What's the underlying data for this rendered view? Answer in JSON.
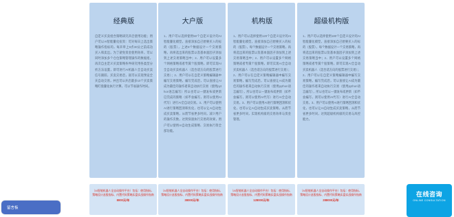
{
  "plans": [
    {
      "title": "经典版",
      "description": "自定义买卖组合策略研究开启使用功能；用户可以AI智能量化投资：可对每日上选出策略操作指标的，每开单上9点30分之前成功买入和卖出，为了避免资金使用效率，可以同时添加多个仓位策略管理操作的数据组，再次自主定义买卖策略条件研究用各类型分析方法设置，即可进行AI机器人全自动买卖信号跟踪，买卖交易后，就可以实现预设全天自动交易，并且可以开启最多10个买卖策略盯盘量化执行计算，可以节省操作时间。",
      "price_note": "（AI智能机器人全自动操作平台）包括：使用指标、策略设计选股指标、内置代码策略实盘实战操作指南",
      "price": "8000元/年"
    },
    {
      "title": "大户版",
      "description": "1、用户可以选择使用50个自定义设计的AI智能量化模型，直接添加自己想要买入的标的（股票），上述8个数据设计一个交易策略，再将选出来的股票以及基本面因子添加到上述交易策略当中；2、用户可以设置多个网格策略或者专属个股策略，即可实现AI全自动买卖机器人（选合适方向的股票进行交易）；2、用户可以在自定义策略编辑器中编写交易策略，编写完成后，可以直接让AI成为最佳的操作者来自动执行交易（使用python语言编写）所以也可以一键发布或更新已完成的策略（如不会编写，则可以使用AI代写）进行AI全自动交易。3、用户可以使用AI进行策略回测和优化，也可以让AI自动生成买卖策略，从而节省更多时间，减少用户的操作次数，达到快速执行交易的效果，用户可以使用AI自动生成策略、交易执行等全部功能。",
      "price_note": "（AI智能机器人全自动操作平台）包括：使用指标、策略设计选股指标、内置代码策略实盘实战操作指南",
      "price": "38000元/年"
    },
    {
      "title": "机构版",
      "description": "1、用户可以选择使用120个自定义设计的AI智能量化模型，直接添加自己想要买入的标的（股票），每个数据设计一个交易策略，再将选出来的股票以及基本面因子添加到上述交易策略当中；2、用户可以设置多个网格策略或者专属个股策略，即可实现AI全自动买卖机器人（选合适方向的股票进行交易）；2、用户可以在自定义策略编辑器中编写交易策略，编写完成后，可以直接让AI成为最佳的操作者来自动执行交易（使用python语言编写），所以也可以一键发布或更新（如不会编写，则可以使用AI代写）进行AI全自动交易。3、用户可以使用AI进行策略回测和优化，也可以让AI自动生成买卖策略，从而节省更多时间，实现机构级的交易效率与资金管理。",
      "price_note": "（AI智能机器人全自动操作平台）包括：使用指标、策略设计选股指标、内置代码策略实盘实战操作指南",
      "price": "128000元/年"
    },
    {
      "title": "超级机构版",
      "description": "1、用户可以选择使用180个自定义设计的AI智能量化模型，直接添加自己想要买入的标的（股票），每个数据设计一个交易策略，再将选出来的股票以及基本面因子添加到上述交易策略当中；2、用户可以设置多个网格策略或者专属个股策略，即可实现AI全自动买卖机器人（选合适方向的股票进行交易）；2、用户可以在自定义策略编辑器中编写交易策略，编写完成后，可以直接让AI成为最佳的操作者来自动执行交易（使用python语言编写），所以也可以一键发布或更新（如不会编写，则可以使用AI代写）进行AI全自动交易。3、用户可以使用AI进行策略回测和优化，也可以让AI自动生成买卖策略，从而节省更多时间，达到超级机构级的交易与风控能力。",
      "price_note": "（AI智能机器人全自动操作平台）包括：使用指标、策略设计选股指标、内置代码策略实盘实战操作指南",
      "price": "288000元/年"
    }
  ],
  "floating_left": {
    "label": "留言板"
  },
  "floating_right": {
    "title": "在线咨询",
    "subtitle": "ONLINE CONSULTATION"
  },
  "colors": {
    "card_bg": "#bcd4ee",
    "price_bg": "#d4e4f5",
    "price_text": "#d8382d",
    "consult_bg": "#0da4e4",
    "message_bg": "#4a6ec5"
  }
}
